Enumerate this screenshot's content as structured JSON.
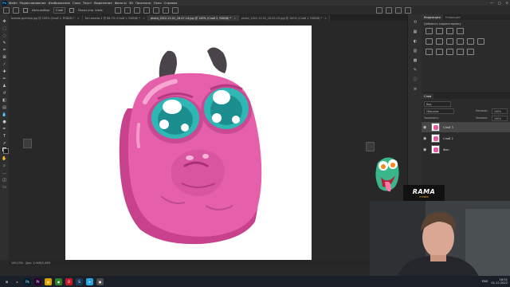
{
  "menubar": {
    "app_icon": "Ps",
    "items": [
      "Файл",
      "Редактирование",
      "Изображение",
      "Слои",
      "Текст",
      "Выделение",
      "Фильтр",
      "3D",
      "Просмотр",
      "Окно",
      "Справка"
    ],
    "window_controls": [
      "—",
      "□",
      "✕"
    ]
  },
  "options_bar": {
    "items": [
      "Авто-выбор:",
      "Слой",
      "Показ.упр. элем."
    ]
  },
  "tabs": [
    {
      "label": "bubble-gumbop.jpg @ 100% (Слой 1, RGB/8) *",
      "active": false
    },
    {
      "label": "Без имени-1 @ 66,7% (Слой 1, RGB/8) *",
      "active": false
    },
    {
      "label": "photo_2022-12-01_16-47-14.jpg @ 149% (Слой 2, RGB/8) *",
      "active": true
    },
    {
      "label": "photo_2022-12-01_16-42-25.jpg @ 100% (Слой 1, RGB/8) *",
      "active": false
    }
  ],
  "status": {
    "zoom": "149,23%",
    "doc": "Док: 1,04M/2,40M"
  },
  "panels": {
    "tabs_top": [
      "Коррекция",
      "Операции"
    ],
    "adjust_title": "Добавить корректировку",
    "layers_tabs": [
      "Слои"
    ],
    "kind_label": "Вид",
    "blend_mode": "Обычные",
    "opacity_label": "Непрозр.:",
    "opacity_value": "100%",
    "lock_label": "Закрепить:",
    "fill_label": "Заливка:",
    "fill_value": "100%",
    "layers": [
      {
        "name": "Слой 3",
        "selected": true
      },
      {
        "name": "Слой 2",
        "selected": false
      },
      {
        "name": "Фон",
        "selected": false
      }
    ]
  },
  "webcam": {
    "brand": "RAMA",
    "subtitle": "create"
  },
  "taskbar": {
    "apps": [
      {
        "name": "windows-icon",
        "color": "#1b1f27",
        "glyph": "⊞"
      },
      {
        "name": "search-icon",
        "color": "#1b1f27",
        "glyph": "⌕"
      },
      {
        "name": "photoshop-icon",
        "color": "#001e36",
        "glyph": "Ps"
      },
      {
        "name": "premiere-icon",
        "color": "#2a0033",
        "glyph": "Pr"
      },
      {
        "name": "explorer-icon",
        "color": "#d9a400",
        "glyph": "▤"
      },
      {
        "name": "chrome-icon",
        "color": "#2f7d32",
        "glyph": "◉"
      },
      {
        "name": "opera-icon",
        "color": "#c2192a",
        "glyph": "O"
      },
      {
        "name": "steam-icon",
        "color": "#1a3a5a",
        "glyph": "S"
      },
      {
        "name": "telegram-icon",
        "color": "#2aa3df",
        "glyph": "➤"
      },
      {
        "name": "app-icon",
        "color": "#4b4b4b",
        "glyph": "▣"
      }
    ],
    "time": "16:51",
    "date": "01.12.2022",
    "lang": "ENG"
  }
}
